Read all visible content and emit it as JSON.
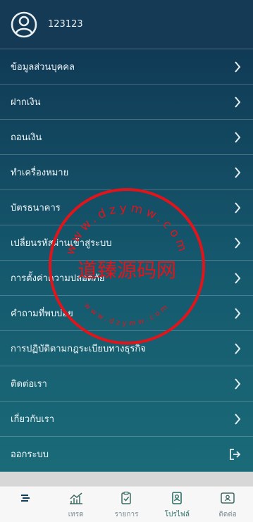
{
  "header": {
    "username": "123123"
  },
  "menu": {
    "items": [
      {
        "label": "ข้อมูลส่วนบุคคล"
      },
      {
        "label": "ฝากเงิน"
      },
      {
        "label": "ถอนเงิน"
      },
      {
        "label": "ทำเครื่องหมาย"
      },
      {
        "label": "บัตรธนาคาร"
      },
      {
        "label": "เปลี่ยนรหัสผ่านเข้าสู่ระบบ"
      },
      {
        "label": "การตั้งค่าความปลอดภัย"
      },
      {
        "label": "คำถามที่พบบ่อย"
      },
      {
        "label": "การปฏิบัติตามกฎระเบียบทางธุรกิจ"
      },
      {
        "label": "ติดต่อเรา"
      },
      {
        "label": "เกี่ยวกับเรา"
      },
      {
        "label": "ออกระบบ"
      }
    ]
  },
  "tabbar": {
    "tabs": [
      {
        "label": "",
        "icon": "brand-logo-icon"
      },
      {
        "label": "เทรด",
        "icon": "trend-chart-icon"
      },
      {
        "label": "รายการ",
        "icon": "clipboard-check-icon"
      },
      {
        "label": "โปรไฟล์",
        "icon": "id-badge-icon",
        "active": true
      },
      {
        "label": "ติดต่อ",
        "icon": "contact-card-icon"
      }
    ]
  },
  "watermark": {
    "center_text": "道臻源码网",
    "ring_text": "www.dzymw.com"
  },
  "colors": {
    "accent": "#2b6f66",
    "stamp": "#e0151b"
  }
}
